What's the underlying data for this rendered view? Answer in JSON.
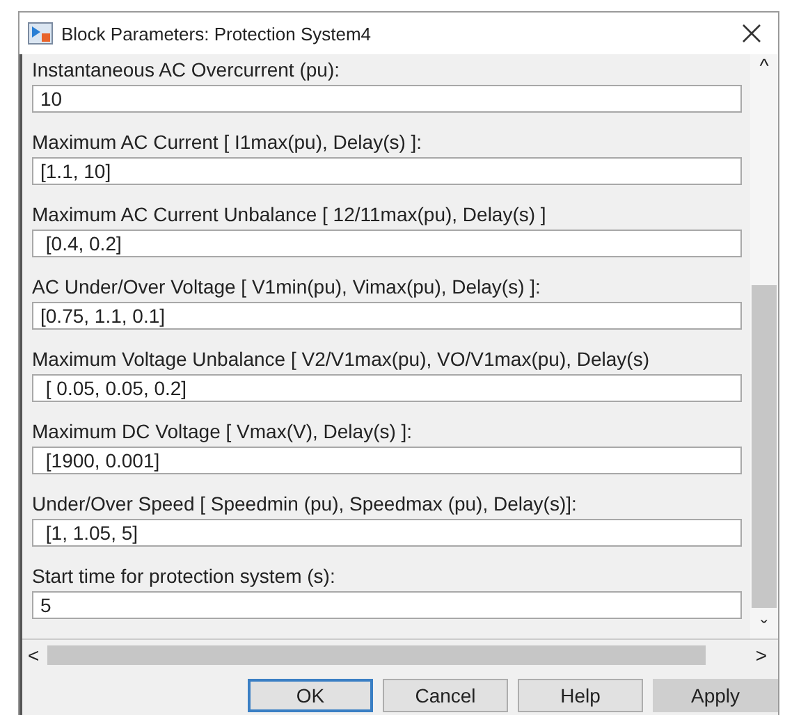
{
  "window": {
    "title": "Block Parameters: Protection System4"
  },
  "parameters": [
    {
      "label": "Instantaneous AC Overcurrent (pu):",
      "value": "10"
    },
    {
      "label": "Maximum AC Current [ I1max(pu), Delay(s) ]:",
      "value": "[1.1, 10]"
    },
    {
      "label": "Maximum AC Current Unbalance [ 12/11max(pu), Delay(s) ]",
      "value": " [0.4, 0.2]"
    },
    {
      "label": "AC Under/Over Voltage [ V1min(pu), Vimax(pu), Delay(s) ]:",
      "value": "[0.75, 1.1, 0.1]"
    },
    {
      "label": "Maximum Voltage Unbalance [ V2/V1max(pu), VO/V1max(pu), Delay(s)",
      "value": " [ 0.05, 0.05, 0.2]"
    },
    {
      "label": "Maximum DC Voltage [ Vmax(V), Delay(s) ]:",
      "value": " [1900, 0.001]"
    },
    {
      "label": "Under/Over Speed [ Speedmin (pu), Speedmax (pu), Delay(s)]:",
      "value": " [1, 1.05, 5]"
    },
    {
      "label": "Start time for protection system (s):",
      "value": "5"
    }
  ],
  "scroll_arrows": {
    "up": "^",
    "down": "ˇ",
    "left": "<",
    "right": ">"
  },
  "buttons": [
    {
      "label": "OK",
      "kind": "default"
    },
    {
      "label": "Cancel",
      "kind": "normal"
    },
    {
      "label": "Help",
      "kind": "normal"
    },
    {
      "label": "Apply",
      "kind": "shaded"
    }
  ]
}
